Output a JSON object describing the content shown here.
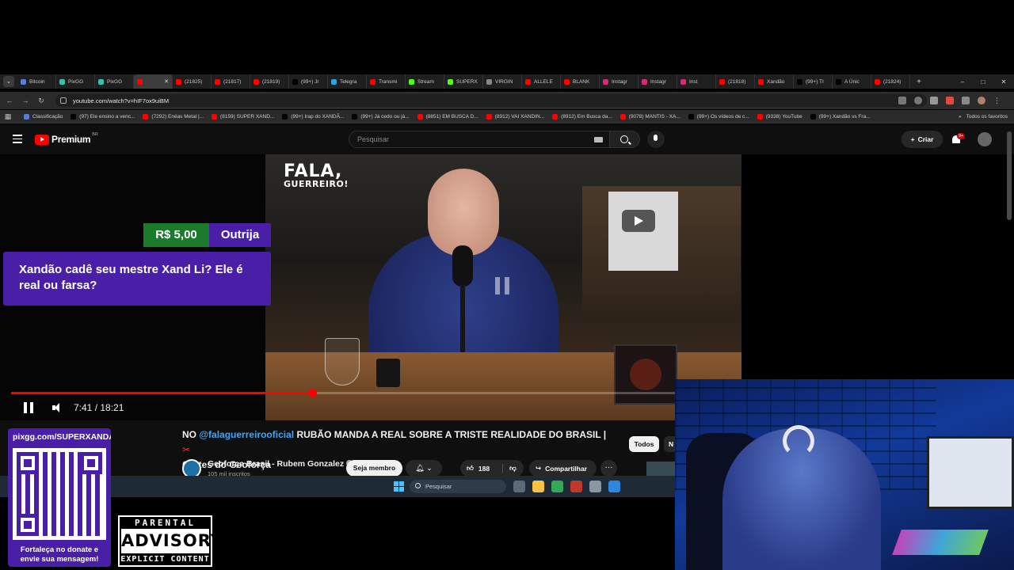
{
  "browser": {
    "tabs": [
      {
        "label": "Bitcoin",
        "color": "#5b7bd5"
      },
      {
        "label": "PixGG",
        "color": "#35c3a8"
      },
      {
        "label": "PixGG",
        "color": "#35c3a8"
      },
      {
        "label": "",
        "color": "#ff0000",
        "active": true
      },
      {
        "label": "(21825)",
        "color": "#ff0000"
      },
      {
        "label": "(21817)",
        "color": "#ff0000"
      },
      {
        "label": "(21819)",
        "color": "#ff0000"
      },
      {
        "label": "(99+) Jr",
        "color": "#000000"
      },
      {
        "label": "Telegra",
        "color": "#2aa3e0"
      },
      {
        "label": "Transmi",
        "color": "#ff0000"
      },
      {
        "label": "Stream",
        "color": "#53fc18"
      },
      {
        "label": "SUPERX",
        "color": "#53fc18"
      },
      {
        "label": "VIRGIN",
        "color": "#888888"
      },
      {
        "label": "ALLELE",
        "color": "#ff0000"
      },
      {
        "label": "BLANK",
        "color": "#ff0000"
      },
      {
        "label": "Instagr",
        "color": "#d62976"
      },
      {
        "label": "Instagr",
        "color": "#d62976"
      },
      {
        "label": "Inst",
        "color": "#d62976"
      },
      {
        "label": "(21818)",
        "color": "#ff0000"
      },
      {
        "label": "Xandão",
        "color": "#ff0000"
      },
      {
        "label": "(99+) TI",
        "color": "#000000"
      },
      {
        "label": "A Únic",
        "color": "#000000"
      },
      {
        "label": "(21824)",
        "color": "#ff0000"
      }
    ],
    "new_tab": "+",
    "window_controls": {
      "minimize": "–",
      "maximize": "□",
      "close": "✕"
    },
    "url": "youtube.com/watch?v=hIF7ox9uiBM",
    "bookmarks": [
      {
        "label": "Classificação",
        "color": "#5b7bd5"
      },
      {
        "label": "(97) Ele ensino a venc...",
        "color": "#000000"
      },
      {
        "label": "(7292) Enéas Metal |...",
        "color": "#ff0000"
      },
      {
        "label": "(8159) SUPER XAND...",
        "color": "#ff0000"
      },
      {
        "label": "(99+) Irap do XANDÃ...",
        "color": "#000000"
      },
      {
        "label": "(99+) Já cedo ou já...",
        "color": "#000000"
      },
      {
        "label": "(8851) EM BUSCA D...",
        "color": "#ff0000"
      },
      {
        "label": "(8912) VAI XANDIN...",
        "color": "#ff0000"
      },
      {
        "label": "(8912) Em Busca da...",
        "color": "#ff0000"
      },
      {
        "label": "(9078) MANTIS - XA...",
        "color": "#ff0000"
      },
      {
        "label": "(99+) Os vídeos de c...",
        "color": "#000000"
      },
      {
        "label": "(9338) YouTube",
        "color": "#ff0000"
      },
      {
        "label": "(99+) Xandão vs Fra...",
        "color": "#000000"
      }
    ],
    "bookmarks_more": "»",
    "all_bookmarks": "Todos os favoritos"
  },
  "youtube": {
    "logo_text": "Premium",
    "region": "BR",
    "search_placeholder": "Pesquisar",
    "create_label": "Criar",
    "notifications_badge": "9+"
  },
  "player": {
    "watermark_line1": "FALA,",
    "watermark_line2": "GUERREIRO!",
    "current_time": "7:41",
    "duration": "18:21",
    "time_display": "7:41 / 18:21",
    "progress_fraction": 0.419
  },
  "donation": {
    "amount": "R$ 5,00",
    "name": "Outrija",
    "message": "Xandão cadê seu mestre Xand Li? Ele é real ou farsa?"
  },
  "video": {
    "title_prefix": "NO",
    "title_mention": "@falaguerreirooficial",
    "title_main": "RUBÃO MANDA A REAL SOBRE A TRISTE REALIDADE DO BRASIL |",
    "title_emoji": "✂",
    "title_suffix": "Cortes do Geoforça",
    "channel_name": "Geoforça Brasil - Rubem Gonzalez",
    "subscribers": "105 mil inscritos",
    "member_label": "Seja membro",
    "like_count": "188",
    "share_label": "Compartilhar",
    "more_label": "···",
    "chip_all": "Todos",
    "chip_next": "N"
  },
  "taskbar": {
    "search_placeholder": "Pesquisar",
    "apps": [
      {
        "name": "task-view",
        "color": "#5b6b7a"
      },
      {
        "name": "explorer",
        "color": "#f5c242"
      },
      {
        "name": "chrome",
        "color": "#34a853"
      },
      {
        "name": "app-red",
        "color": "#c0392b"
      },
      {
        "name": "settings",
        "color": "#8a96a3"
      },
      {
        "name": "app-blue",
        "color": "#2e86de"
      }
    ]
  },
  "overlay": {
    "qr_url": "pixgg.com/SUPERXANDAO",
    "qr_text": "Fortaleça no donate e envie sua mensagem!",
    "advisory_top": "PARENTAL",
    "advisory_mid": "ADVISORY",
    "advisory_bottom": "EXPLICIT CONTENT"
  },
  "colors": {
    "donation_green": "#1c7a2c",
    "donation_purple": "#4a1fa8",
    "progress_red": "#ff0000",
    "mention_blue": "#3ea6ff"
  }
}
